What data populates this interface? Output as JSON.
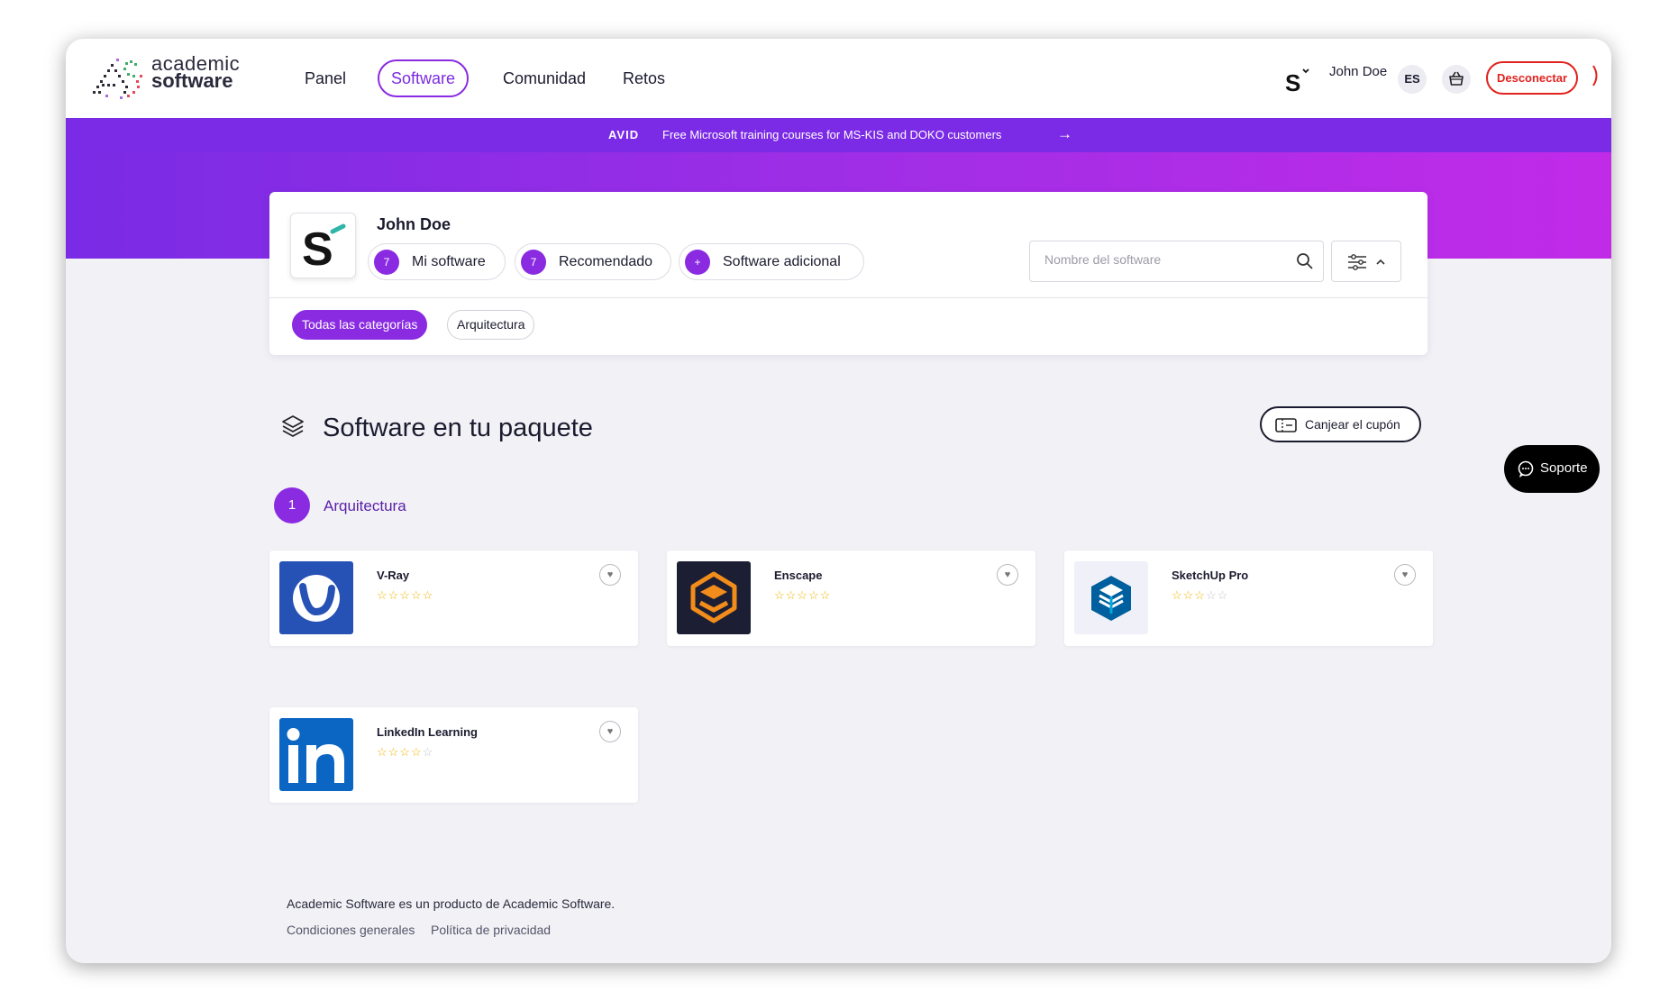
{
  "brand": {
    "logo_line1": "academic",
    "logo_line2": "software"
  },
  "nav": {
    "items": [
      {
        "label": "Panel"
      },
      {
        "label": "Software"
      },
      {
        "label": "Comunidad"
      },
      {
        "label": "Retos"
      }
    ],
    "user_name": "John Doe",
    "language": "ES",
    "logout_label": "Desconectar"
  },
  "banner": {
    "logo_text": "AVID",
    "text": "Free Microsoft training courses for MS-KIS and DOKO customers",
    "arrow": "→"
  },
  "profile": {
    "name": "John Doe",
    "pills": [
      {
        "count": "7",
        "label": "Mi software"
      },
      {
        "count": "7",
        "label": "Recomendado"
      },
      {
        "count": "+",
        "label": "Software adicional"
      }
    ],
    "search_placeholder": "Nombre del software",
    "categories": [
      {
        "label": "Todas las categorías",
        "active": true
      },
      {
        "label": "Arquitectura",
        "active": false
      }
    ]
  },
  "section": {
    "title": "Software en tu paquete",
    "coupon_label": "Canjear el cupón",
    "category_count": "1",
    "category_title": "Arquitectura"
  },
  "products": [
    {
      "name": "V-Ray",
      "rating": 0,
      "max_rating": 5,
      "icon": "vray-logo"
    },
    {
      "name": "Enscape",
      "rating": 0,
      "max_rating": 5,
      "icon": "enscape-logo"
    },
    {
      "name": "SketchUp Pro",
      "rating": 0,
      "max_rating": 5,
      "icon": "sketchup-logo"
    },
    {
      "name": "LinkedIn Learning",
      "rating": 0,
      "max_rating": 5,
      "icon": "linkedin-logo"
    }
  ],
  "support": {
    "label": "Soporte"
  },
  "footer": {
    "line": "Academic Software es un producto de Academic Software.",
    "links": [
      "Condiciones generales",
      "Política de privacidad"
    ]
  },
  "colors": {
    "accent": "#8a2be2",
    "banner": "#7b2be6",
    "logout": "#e0231f",
    "star": "#f0b400"
  }
}
